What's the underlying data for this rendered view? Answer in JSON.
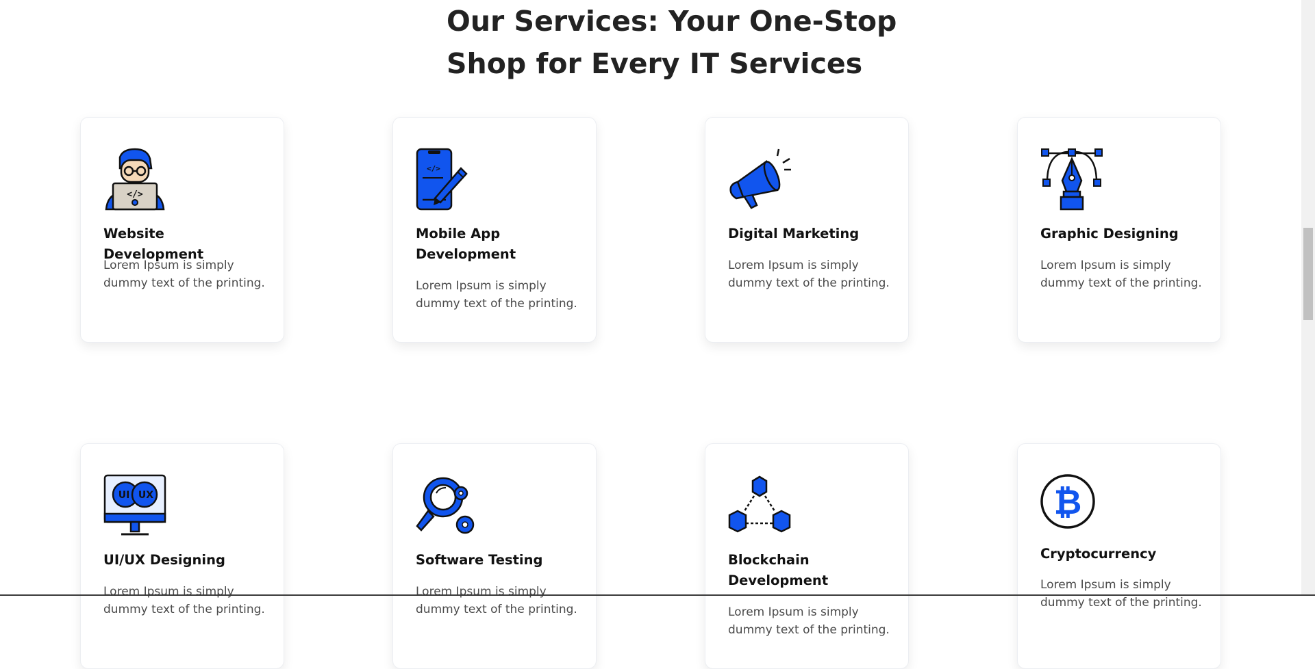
{
  "heading": {
    "line1": "Our Services: Your One-Stop",
    "line2": "Shop for Every IT Services"
  },
  "services": [
    {
      "title": "Website Development",
      "description": "Lorem Ipsum is simply dummy text of the printing.",
      "icon": "developer-laptop-icon"
    },
    {
      "title": "Mobile App Development",
      "description": "Lorem Ipsum is simply dummy text of the printing.",
      "icon": "mobile-code-icon"
    },
    {
      "title": "Digital Marketing",
      "description": "Lorem Ipsum is simply dummy text of the printing.",
      "icon": "megaphone-icon"
    },
    {
      "title": "Graphic Designing",
      "description": "Lorem Ipsum is simply dummy text of the printing.",
      "icon": "pen-tool-icon"
    },
    {
      "title": "UI/UX Designing",
      "description": "Lorem Ipsum is simply dummy text of the printing.",
      "icon": "ui-ux-monitor-icon"
    },
    {
      "title": "Software Testing",
      "description": "Lorem Ipsum is simply dummy text of the printing.",
      "icon": "magnifier-gears-icon"
    },
    {
      "title": "Blockchain Development",
      "description": "Lorem Ipsum is simply dummy text of the printing.",
      "icon": "blockchain-cubes-icon"
    },
    {
      "title": "Cryptocurrency",
      "description": "Lorem Ipsum is simply dummy text of the printing.",
      "icon": "bitcoin-icon"
    }
  ],
  "colors": {
    "accent": "#1155ee",
    "heading": "#222222",
    "body_text": "#4a4a4a"
  }
}
